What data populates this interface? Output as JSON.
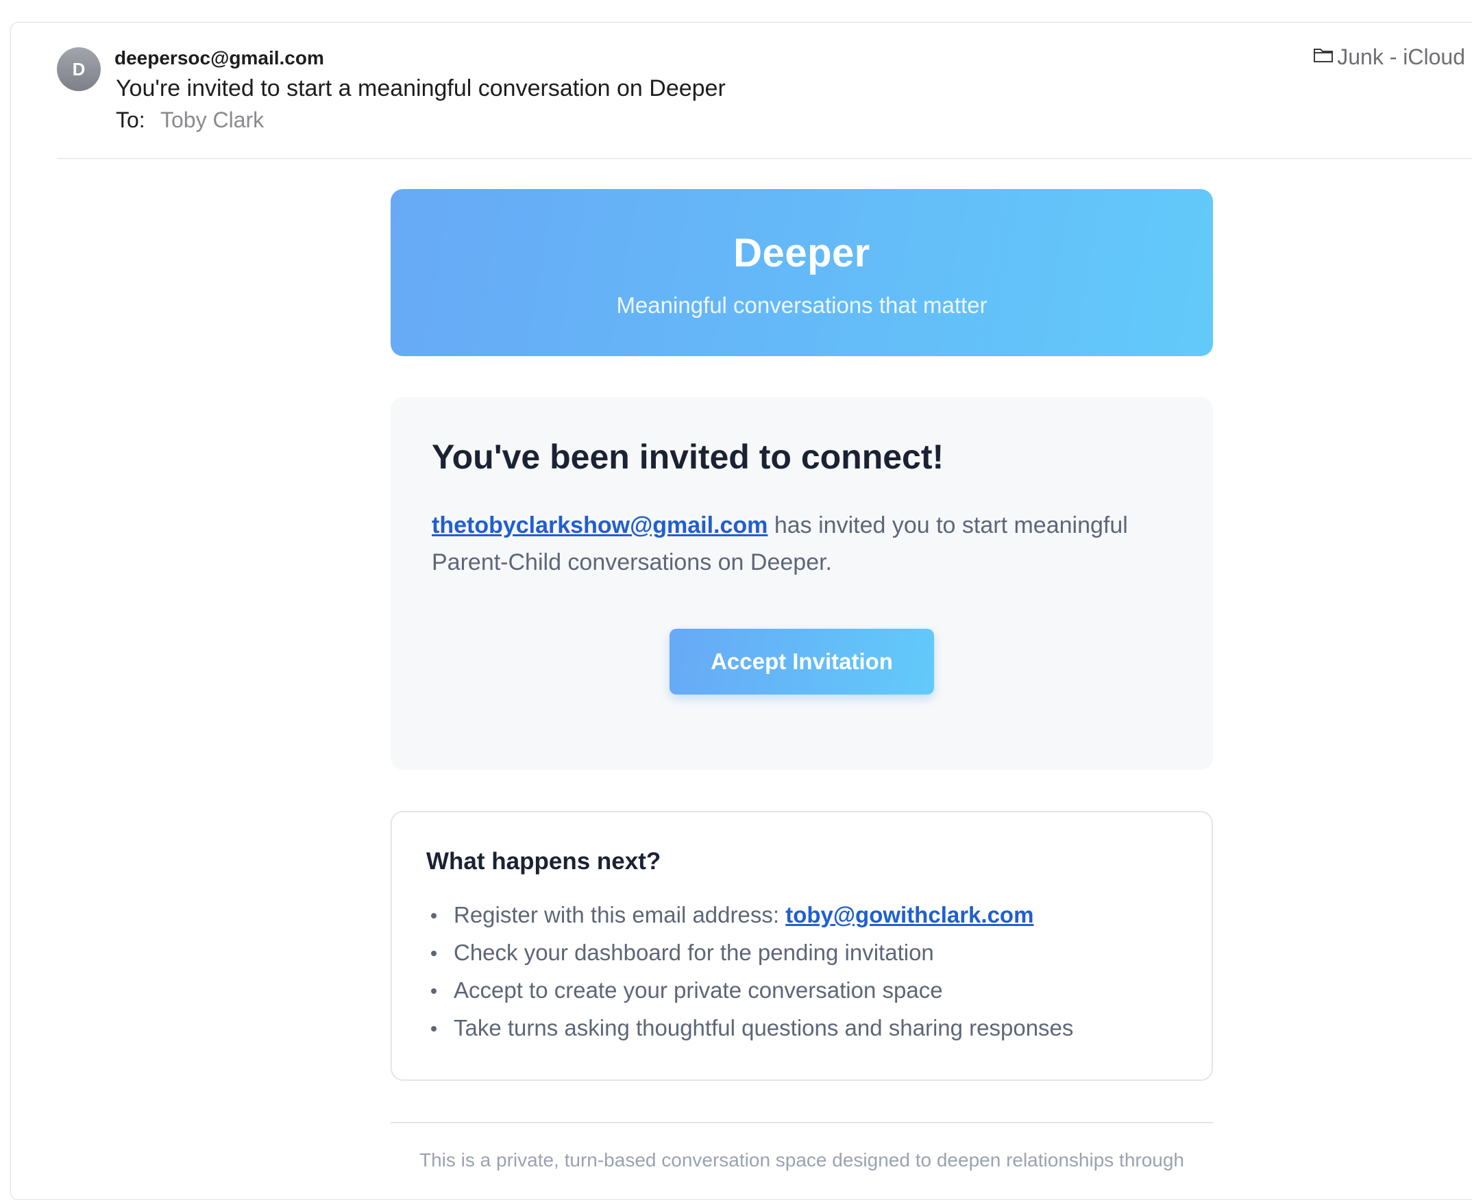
{
  "header": {
    "avatar_initial": "D",
    "from": "deepersoc@gmail.com",
    "subject": "You're invited to start a meaningful conversation on Deeper",
    "to_label": "To:",
    "to_name": "Toby Clark",
    "folder": "Junk - iCloud",
    "folder_icon": "folder-icon"
  },
  "hero": {
    "title": "Deeper",
    "subtitle": "Meaningful conversations that matter"
  },
  "invite": {
    "title": "You've been invited to connect!",
    "inviter_email": "thetobyclarkshow@gmail.com",
    "message": " has invited you to start meaningful Parent-Child conversations on Deeper.",
    "accept_label": "Accept Invitation"
  },
  "next_steps": {
    "title": "What happens next?",
    "register_prefix": "Register with this email address: ",
    "register_email": "toby@gowithclark.com",
    "items": [
      "Check your dashboard for the pending invitation",
      "Accept to create your private conversation space",
      "Take turns asking thoughtful questions and sharing responses"
    ]
  },
  "footer": {
    "text": "This is a private, turn-based conversation space designed to deepen relationships through"
  },
  "colors": {
    "accent_gradient_start": "#67a9f6",
    "accent_gradient_end": "#62cafa",
    "link": "#1f5fcf",
    "heading": "#1a2233",
    "body_text": "#5d6678"
  }
}
